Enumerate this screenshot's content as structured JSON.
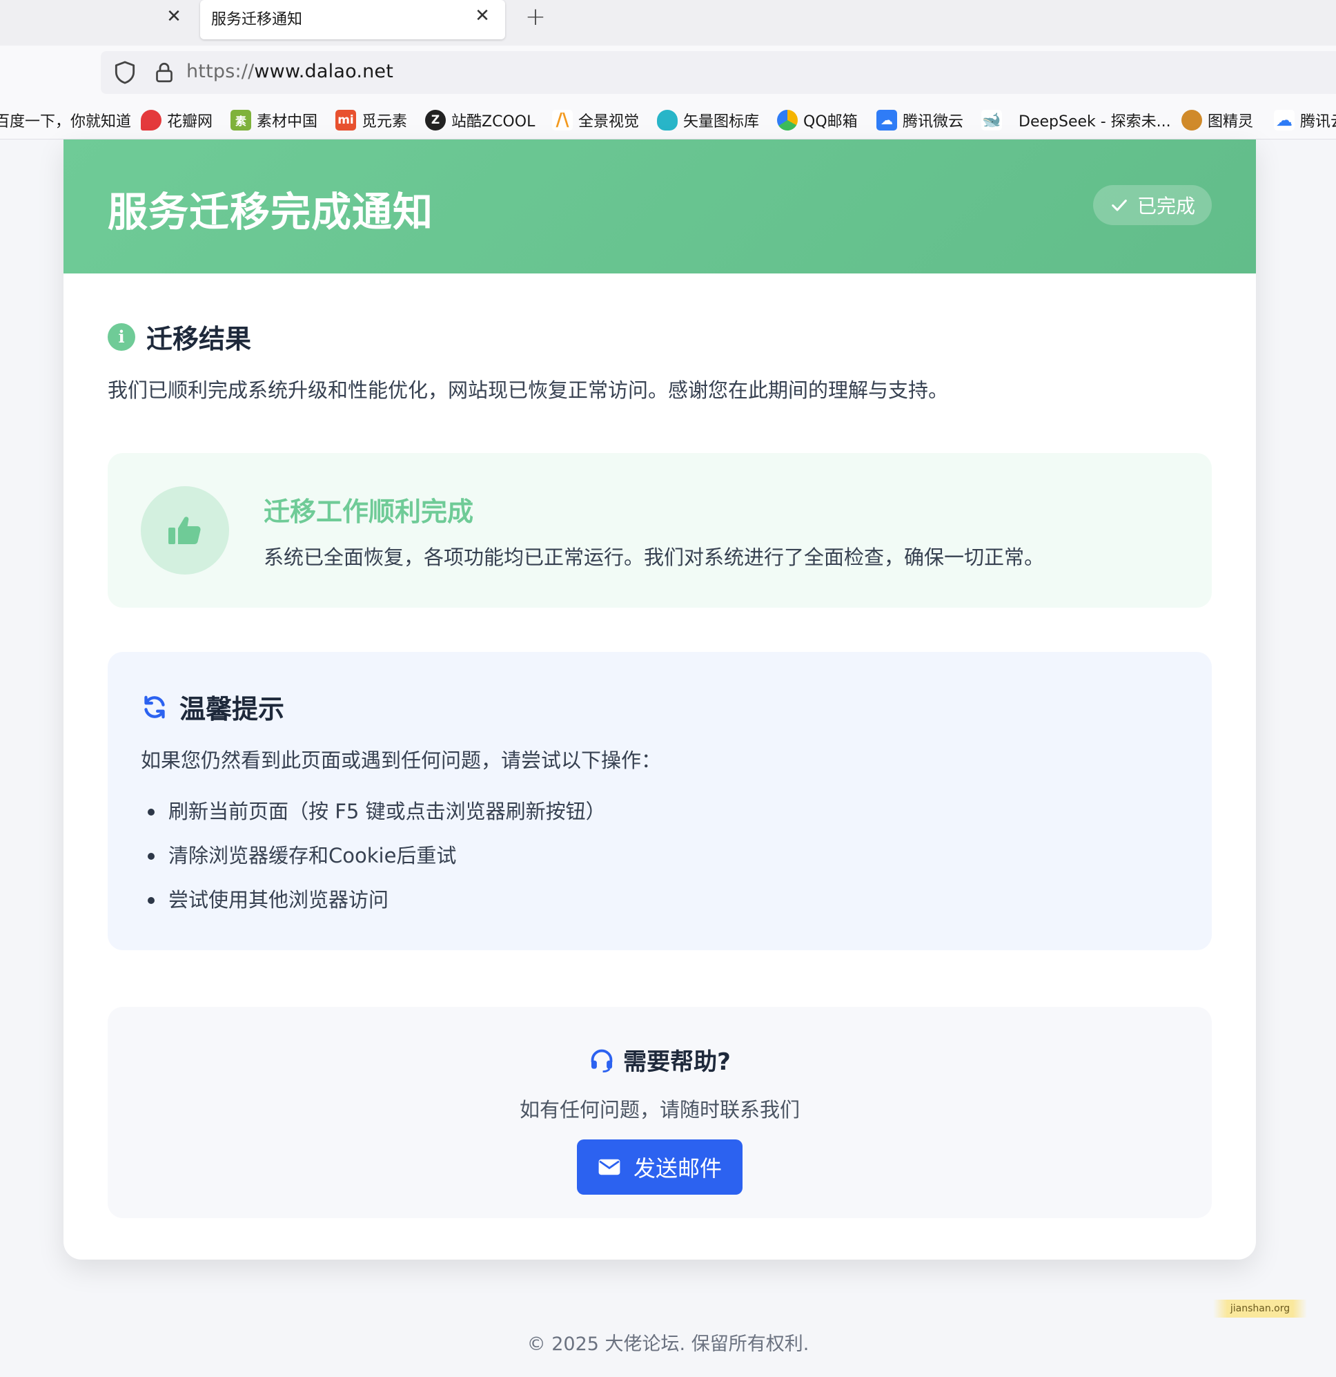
{
  "browser": {
    "active_tab_title": "服务迁移通知",
    "url_scheme": "https://",
    "url_host": "www.dalao.net",
    "bookmarks": [
      {
        "label": "百度一下，你就知道",
        "icon": "baidu-icon",
        "color": "#ffffff"
      },
      {
        "label": "花瓣网",
        "icon": "huaban-icon",
        "color": "#e4393c"
      },
      {
        "label": "素材中国",
        "icon": "sucai-icon",
        "color": "#7fb23b"
      },
      {
        "label": "觅元素",
        "icon": "mi-icon",
        "color": "#e8512f"
      },
      {
        "label": "站酷ZCOOL",
        "icon": "zcool-icon",
        "color": "#222222"
      },
      {
        "label": "全景视觉",
        "icon": "quanjing-icon",
        "color": "#f39a1f"
      },
      {
        "label": "矢量图标库",
        "icon": "iconfont-icon",
        "color": "#28b5c8"
      },
      {
        "label": "QQ邮箱",
        "icon": "qqmail-icon",
        "color": "#f5b400"
      },
      {
        "label": "腾讯微云",
        "icon": "weiyun-icon",
        "color": "#2f7cf6"
      },
      {
        "label": "DeepSeek - 探索未...",
        "icon": "deepseek-icon",
        "color": "#4d6bfe"
      },
      {
        "label": "图精灵",
        "icon": "tujingling-icon",
        "color": "#d08a2a"
      },
      {
        "label": "腾讯云",
        "icon": "tencent-cloud-icon",
        "color": "#2f7cf6"
      }
    ]
  },
  "hero": {
    "title": "服务迁移完成通知",
    "badge": "已完成",
    "color": "#6fcb97"
  },
  "result": {
    "title": "迁移结果",
    "text": "我们已顺利完成系统升级和性能优化，网站现已恢复正常访问。感谢您在此期间的理解与支持。"
  },
  "success": {
    "title": "迁移工作顺利完成",
    "text": "系统已全面恢复，各项功能均已正常运行。我们对系统进行了全面检查，确保一切正常。"
  },
  "tips": {
    "title": "温馨提示",
    "lead": "如果您仍然看到此页面或遇到任何问题，请尝试以下操作：",
    "items": [
      "刷新当前页面（按 F5 键或点击浏览器刷新按钮）",
      "清除浏览器缓存和Cookie后重试",
      "尝试使用其他浏览器访问"
    ]
  },
  "help": {
    "title": "需要帮助?",
    "text": "如有任何问题，请随时联系我们",
    "button": "发送邮件",
    "button_color": "#2c62f0"
  },
  "watermark": "jianshan.org",
  "footer": "© 2025 大佬论坛. 保留所有权利."
}
